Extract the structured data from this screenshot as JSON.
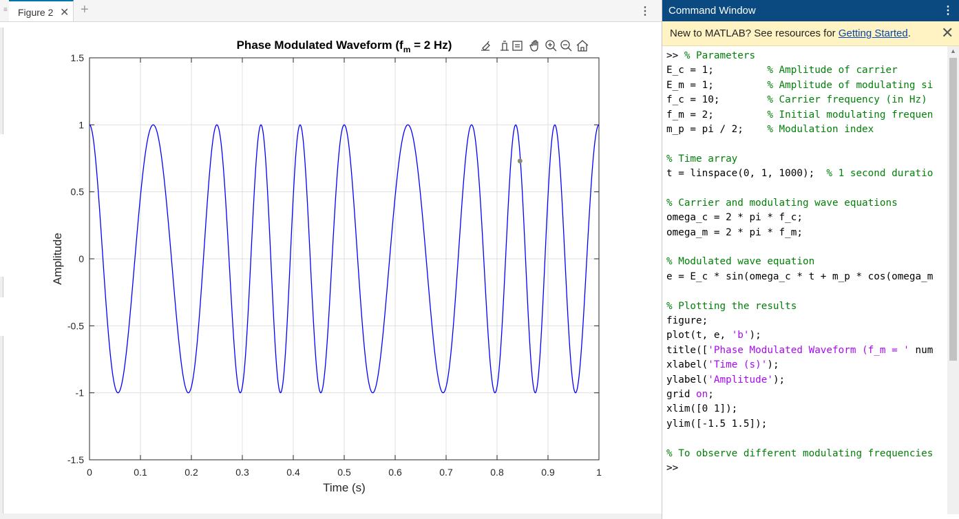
{
  "figure_tab": {
    "label": "Figure 2",
    "close_glyph": "✕",
    "add_glyph": "+",
    "menu_glyph": "⋮"
  },
  "axes_toolbar": {
    "icons": [
      "brush-icon",
      "data-tips-icon",
      "export-icon",
      "pan-icon",
      "zoom-in-icon",
      "zoom-out-icon",
      "home-icon"
    ]
  },
  "chart_data": {
    "type": "line",
    "title": "Phase Modulated Waveform (f_m = 2 Hz)",
    "title_main": "Phase  Modulated  Waveform  (f",
    "title_sub": "m",
    "title_tail": " =  2  Hz)",
    "xlabel": "Time (s)",
    "ylabel": "Amplitude",
    "xlim": [
      0,
      1
    ],
    "ylim": [
      -1.5,
      1.5
    ],
    "xticks": [
      0,
      0.1,
      0.2,
      0.3,
      0.4,
      0.5,
      0.6,
      0.7,
      0.8,
      0.9,
      1
    ],
    "xtick_labels": [
      "0",
      "0.1",
      "0.2",
      "0.3",
      "0.4",
      "0.5",
      "0.6",
      "0.7",
      "0.8",
      "0.9",
      "1"
    ],
    "yticks": [
      -1.5,
      -1,
      -0.5,
      0,
      0.5,
      1,
      1.5
    ],
    "ytick_labels": [
      "-1.5",
      "-1",
      "-0.5",
      "0",
      "0.5",
      "1",
      "1.5"
    ],
    "grid": true,
    "series": [
      {
        "color": "#0000ff",
        "formula": "e = E_c * sin(2*pi*f_c*t + m_p*cos(2*pi*f_m*t))",
        "params": {
          "E_c": 1,
          "f_c": 10,
          "m_p": 1.5708,
          "f_m": 2
        },
        "samples": 1000
      }
    ],
    "marker_point": {
      "x": 0.845,
      "y": 0.73,
      "color": "#8a8a6e"
    }
  },
  "command_window": {
    "title": "Command Window",
    "menu_glyph": "⋮",
    "banner_text": "New to MATLAB? See resources for ",
    "banner_link": "Getting Started",
    "banner_suffix": ".",
    "banner_close": "✕",
    "lines": [
      [
        {
          "t": ">> ",
          "c": "n"
        },
        {
          "t": "% Parameters",
          "c": "c"
        }
      ],
      [
        {
          "t": "E_c = 1;         ",
          "c": "n"
        },
        {
          "t": "% Amplitude of carrier",
          "c": "c"
        }
      ],
      [
        {
          "t": "E_m = 1;         ",
          "c": "n"
        },
        {
          "t": "% Amplitude of modulating si",
          "c": "c"
        }
      ],
      [
        {
          "t": "f_c = 10;        ",
          "c": "n"
        },
        {
          "t": "% Carrier frequency (in Hz)",
          "c": "c"
        }
      ],
      [
        {
          "t": "f_m = 2;         ",
          "c": "n"
        },
        {
          "t": "% Initial modulating frequen",
          "c": "c"
        }
      ],
      [
        {
          "t": "m_p = pi / 2;    ",
          "c": "n"
        },
        {
          "t": "% Modulation index",
          "c": "c"
        }
      ],
      [],
      [
        {
          "t": "% Time array",
          "c": "c"
        }
      ],
      [
        {
          "t": "t = linspace(0, 1, 1000);  ",
          "c": "n"
        },
        {
          "t": "% 1 second duratio",
          "c": "c"
        }
      ],
      [],
      [
        {
          "t": "% Carrier and modulating wave equations",
          "c": "c"
        }
      ],
      [
        {
          "t": "omega_c = 2 * pi * f_c;",
          "c": "n"
        }
      ],
      [
        {
          "t": "omega_m = 2 * pi * f_m;",
          "c": "n"
        }
      ],
      [],
      [
        {
          "t": "% Modulated wave equation",
          "c": "c"
        }
      ],
      [
        {
          "t": "e = E_c * sin(omega_c * t + m_p * cos(omega_m",
          "c": "n"
        }
      ],
      [],
      [
        {
          "t": "% Plotting the results",
          "c": "c"
        }
      ],
      [
        {
          "t": "figure;",
          "c": "n"
        }
      ],
      [
        {
          "t": "plot(t, e, ",
          "c": "n"
        },
        {
          "t": "'b'",
          "c": "s"
        },
        {
          "t": ");",
          "c": "n"
        }
      ],
      [
        {
          "t": "title([",
          "c": "n"
        },
        {
          "t": "'Phase Modulated Waveform (f_m = '",
          "c": "s"
        },
        {
          "t": " num",
          "c": "n"
        }
      ],
      [
        {
          "t": "xlabel(",
          "c": "n"
        },
        {
          "t": "'Time (s)'",
          "c": "s"
        },
        {
          "t": ");",
          "c": "n"
        }
      ],
      [
        {
          "t": "ylabel(",
          "c": "n"
        },
        {
          "t": "'Amplitude'",
          "c": "s"
        },
        {
          "t": ");",
          "c": "n"
        }
      ],
      [
        {
          "t": "grid ",
          "c": "n"
        },
        {
          "t": "on",
          "c": "s"
        },
        {
          "t": ";",
          "c": "n"
        }
      ],
      [
        {
          "t": "xlim([0 1]);",
          "c": "n"
        }
      ],
      [
        {
          "t": "ylim([-1.5 1.5]);",
          "c": "n"
        }
      ],
      [],
      [
        {
          "t": "% To observe different modulating frequencies",
          "c": "c"
        }
      ],
      [
        {
          "t": ">> ",
          "c": "n"
        }
      ]
    ]
  }
}
